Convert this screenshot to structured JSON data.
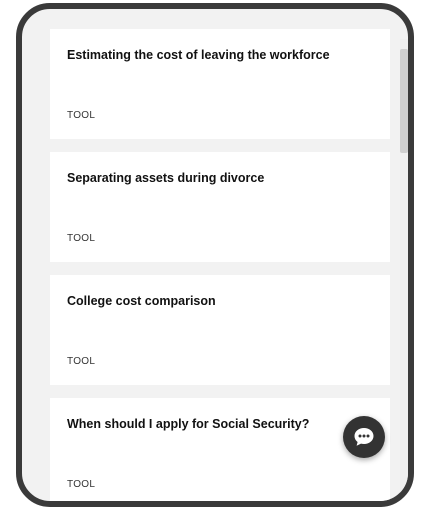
{
  "cards": [
    {
      "title": "Estimating the cost of leaving the workforce",
      "type": "TOOL"
    },
    {
      "title": "Separating assets during divorce",
      "type": "TOOL"
    },
    {
      "title": "College cost comparison",
      "type": "TOOL"
    },
    {
      "title": "When should I apply for Social Security?",
      "type": "TOOL"
    }
  ],
  "chat": {
    "icon": "chat-bubble-icon"
  },
  "colors": {
    "frame": "#3a3a3a",
    "background": "#f2f2f2",
    "card": "#ffffff",
    "chat_button": "#333333"
  }
}
